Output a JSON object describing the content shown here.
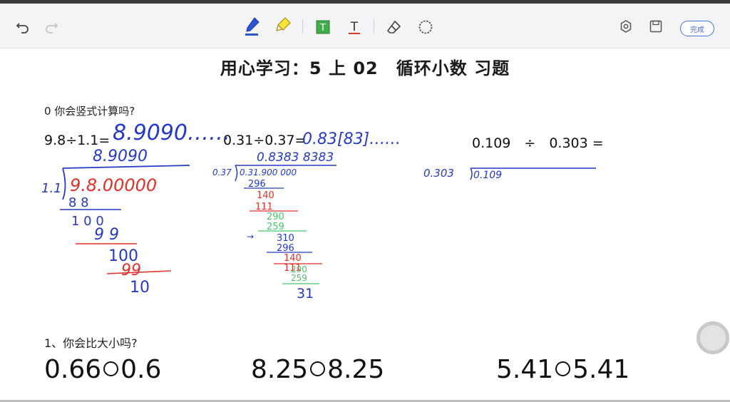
{
  "toolbar": {
    "icons": [
      "undo-icon",
      "redo-icon",
      "pen-icon",
      "highlighter-icon",
      "text-box-icon",
      "text-icon",
      "eraser-icon",
      "lasso-icon",
      "settings-icon",
      "save-icon"
    ],
    "done_label": "完成",
    "colors": {
      "accent": "#4a6fd9",
      "pen_blue": "#1f3fb8",
      "text_green": "#3fae49",
      "text_red": "#d93b2b"
    }
  },
  "page": {
    "title": "用心学习：5 上 02　循环小数 习题",
    "section0": {
      "question": "0 你会竖式计算吗?",
      "problems": [
        {
          "expr": "9.8÷1.1=",
          "answer_handwritten": "8.9090……"
        },
        {
          "expr": "0.31÷0.37=",
          "answer_handwritten": "0.83[83]……"
        },
        {
          "expr": "0.109　÷　0.303 ="
        }
      ]
    },
    "section1": {
      "question": "1、你会比大小吗?",
      "comparisons": [
        {
          "left": "0.66",
          "right": "0.6"
        },
        {
          "left": "8.25",
          "right": "8.25"
        },
        {
          "left": "5.41",
          "right": "5.41"
        }
      ]
    }
  },
  "ink": {
    "colors": {
      "blue": "#2439c8",
      "red": "#e0322a",
      "green": "#4cc36a",
      "dark": "#1a1a1a"
    },
    "work1": [
      "8.9090",
      "1.1",
      "9.8.00000",
      "8 8",
      "1 0 0",
      "9 9",
      "100",
      "99",
      "10"
    ],
    "work2": [
      "0.8383 8383",
      "0.37",
      "0.31.900 000",
      "296",
      "140",
      "111",
      "290",
      "259",
      "310",
      "296",
      "140",
      "111",
      "290",
      "259",
      "31"
    ],
    "work3": [
      "0.303",
      "0.109"
    ]
  }
}
